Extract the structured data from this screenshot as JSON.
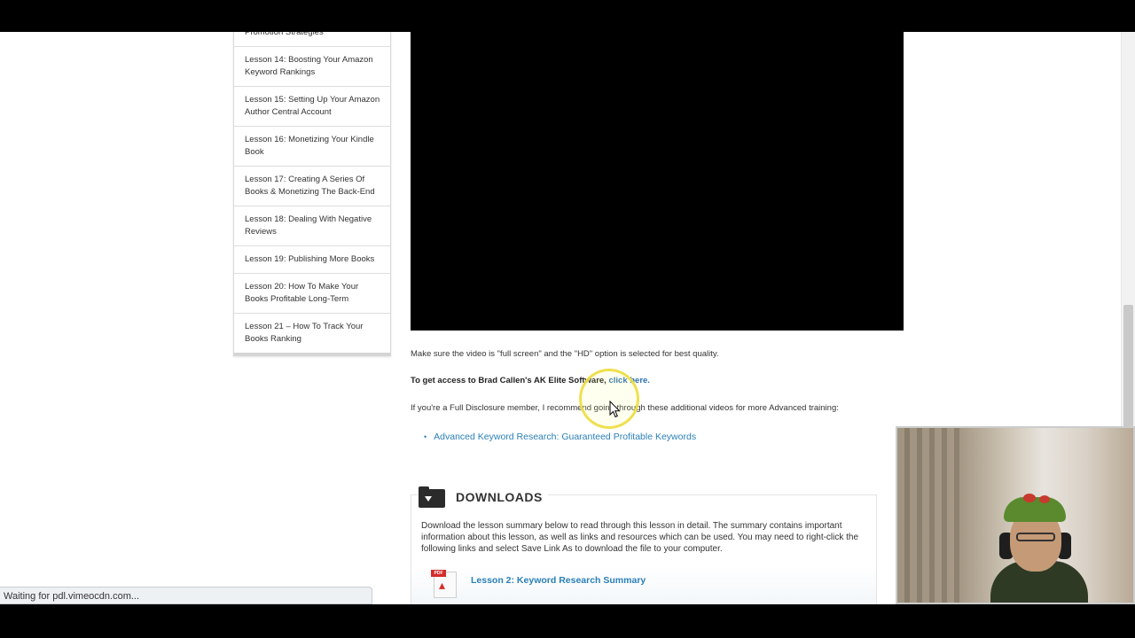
{
  "sidebar": {
    "items": [
      {
        "label": "Promotion Strategies"
      },
      {
        "label": "Lesson 14: Boosting Your Amazon Keyword Rankings"
      },
      {
        "label": "Lesson 15: Setting Up Your Amazon Author Central Account"
      },
      {
        "label": "Lesson 16: Monetizing Your Kindle Book"
      },
      {
        "label": "Lesson 17: Creating A Series Of Books & Monetizing The Back-End"
      },
      {
        "label": "Lesson 18: Dealing With Negative Reviews"
      },
      {
        "label": "Lesson 19: Publishing More Books"
      },
      {
        "label": "Lesson 20: How To Make Your Books Profitable Long-Term"
      },
      {
        "label": "Lesson 21 – How To Track Your Books Ranking"
      }
    ]
  },
  "content": {
    "video_note": "Make sure the video is \"full screen\" and the \"HD\" option is selected for best quality.",
    "access_text": "To get access to Brad Callen's AK Elite Software,",
    "access_link": "click here.",
    "disclosure_text": "If you're a Full Disclosure member, I recommend going through these additional videos for more Advanced training:",
    "extra_videos": [
      {
        "label": "Advanced Keyword Research: Guaranteed Profitable Keywords"
      }
    ]
  },
  "downloads": {
    "title": "DOWNLOADS",
    "description": "Download the lesson summary below to read through this lesson in detail.  The summary contains important information about this lesson, as well as links and resources which can be used.  You may need to right-click the following links and select Save Link As to download the file to your computer.",
    "link_label": "Lesson 2: Keyword Research Summary",
    "pdf_badge": "PDF",
    "pdf_brand": "Adobe"
  },
  "status_bar": {
    "text": "Waiting for pdl.vimeocdn.com..."
  },
  "icons": {
    "folder": "folder-download-icon",
    "pdf": "pdf-file-icon",
    "cursor": "mouse-pointer-icon"
  },
  "colors": {
    "link": "#2a7fb8",
    "highlight_ring": "#eede46",
    "pdf_red": "#d42c2c"
  }
}
